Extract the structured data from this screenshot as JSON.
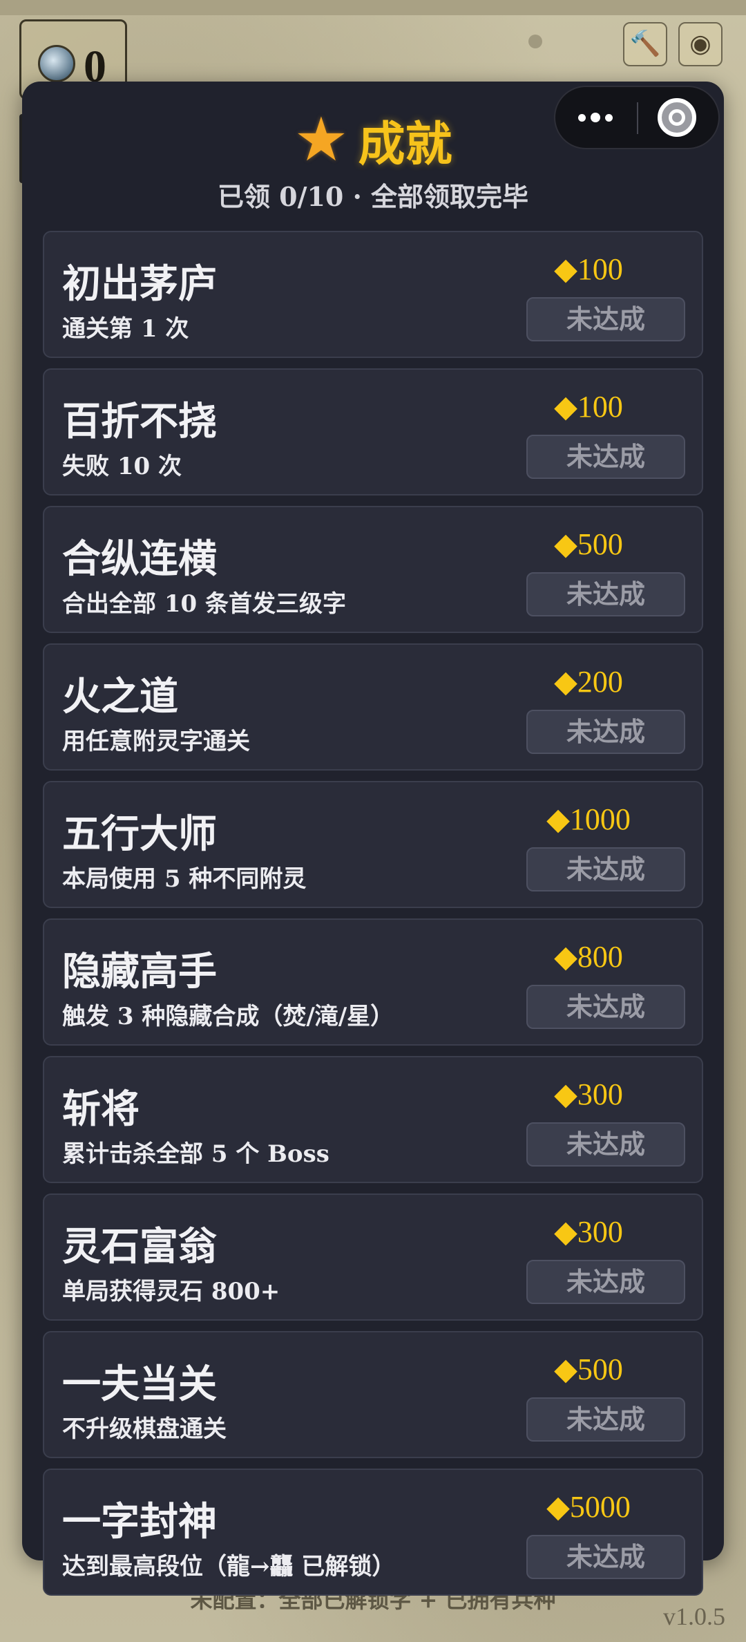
{
  "background": {
    "gem_count": "0",
    "hammer_icon": "hammer-icon",
    "coin_icon": "coin-icon",
    "footer_text": "未配置：全部已解锁字 + 已拥有兵种",
    "version": "v1.0.5"
  },
  "capsule": {
    "more_icon": "more-dots-icon",
    "close_icon": "close-target-icon"
  },
  "header": {
    "star_icon": "★",
    "title": "成就",
    "subtitle": "已领 0/10 · 全部领取完毕"
  },
  "colors": {
    "panel_bg": "#20222d",
    "card_bg": "#2a2c39",
    "accent_gold": "#f7c31b",
    "status_text": "#9b9ca6"
  },
  "achievements": [
    {
      "title": "初出茅庐",
      "desc": "通关第 1 次",
      "reward": "◆100",
      "status": "未达成"
    },
    {
      "title": "百折不挠",
      "desc": "失败 10 次",
      "reward": "◆100",
      "status": "未达成"
    },
    {
      "title": "合纵连横",
      "desc": "合出全部 10 条首发三级字",
      "reward": "◆500",
      "status": "未达成"
    },
    {
      "title": "火之道",
      "desc": "用任意附灵字通关",
      "reward": "◆200",
      "status": "未达成"
    },
    {
      "title": "五行大师",
      "desc": "本局使用 5 种不同附灵",
      "reward": "◆1000",
      "status": "未达成"
    },
    {
      "title": "隐藏高手",
      "desc": "触发 3 种隐藏合成（焚/滝/星）",
      "reward": "◆800",
      "status": "未达成"
    },
    {
      "title": "斩将",
      "desc": "累计击杀全部 5 个 Boss",
      "reward": "◆300",
      "status": "未达成"
    },
    {
      "title": "灵石富翁",
      "desc": "单局获得灵石 800+",
      "reward": "◆300",
      "status": "未达成"
    },
    {
      "title": "一夫当关",
      "desc": "不升级棋盘通关",
      "reward": "◆500",
      "status": "未达成"
    },
    {
      "title": "一字封神",
      "desc": "达到最高段位（龍→龘 已解锁）",
      "reward": "◆5000",
      "status": "未达成"
    }
  ]
}
